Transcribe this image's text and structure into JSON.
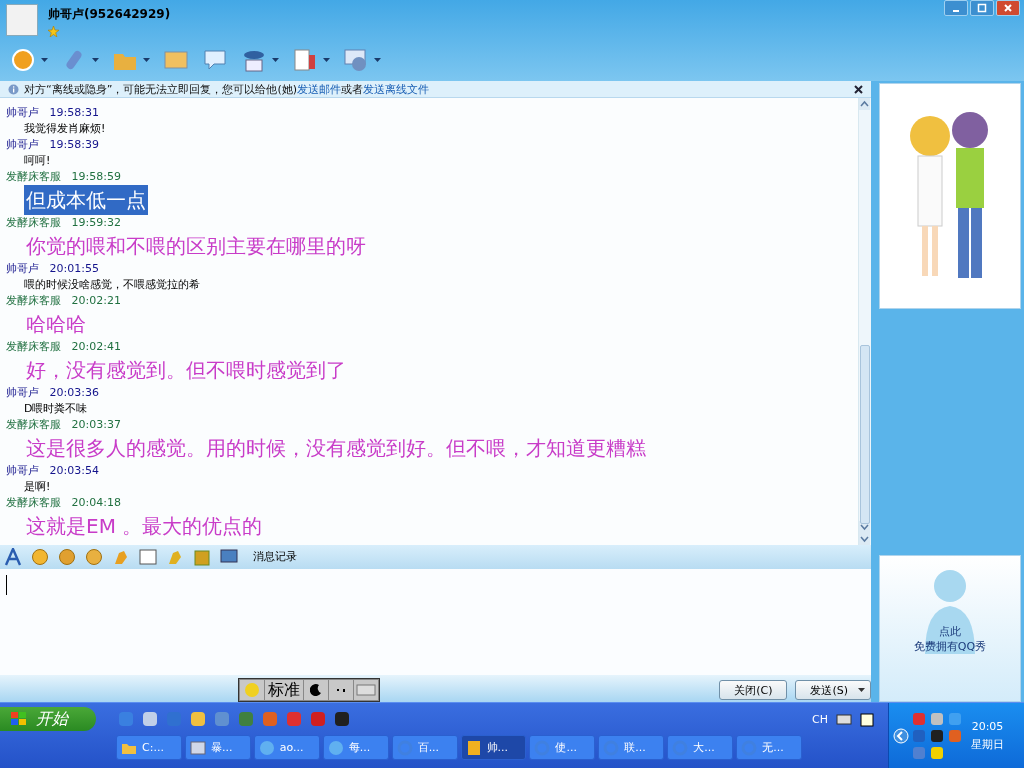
{
  "window": {
    "title": "帅哥卢(952642929)"
  },
  "toolbar": [
    {
      "kind": "webcam",
      "dropdown": true
    },
    {
      "kind": "mic",
      "dropdown": true
    },
    {
      "kind": "folder",
      "dropdown": true
    },
    {
      "kind": "mail",
      "dropdown": false
    },
    {
      "kind": "chat",
      "dropdown": false
    },
    {
      "kind": "person",
      "dropdown": true
    },
    {
      "kind": "cards",
      "dropdown": true
    },
    {
      "kind": "gear",
      "dropdown": true
    }
  ],
  "notice": {
    "text_before": "对方“离线或隐身”，可能无法立即回复，您可以给他(她)",
    "link_1": "发送邮件",
    "text_middle": "或者",
    "link_2": "发送离线文件"
  },
  "messages": [
    {
      "sender": "帅哥卢",
      "kind": "self",
      "time": "19:58:31",
      "text": "我觉得发肖麻烦!",
      "selected": false
    },
    {
      "sender": "帅哥卢",
      "kind": "self",
      "time": "19:58:39",
      "text": "呵呵!",
      "selected": false
    },
    {
      "sender": "发酵床客服",
      "kind": "other",
      "time": "19:58:59",
      "text": "但成本低一点",
      "selected": true
    },
    {
      "sender": "发酵床客服",
      "kind": "other",
      "time": "19:59:32",
      "text": "你觉的喂和不喂的区别主要在哪里的呀",
      "selected": false
    },
    {
      "sender": "帅哥卢",
      "kind": "self",
      "time": "20:01:55",
      "text": "喂的时候没啥感觉，不喂感觉拉的希",
      "selected": false
    },
    {
      "sender": "发酵床客服",
      "kind": "other",
      "time": "20:02:21",
      "text": "哈哈哈",
      "selected": false
    },
    {
      "sender": "发酵床客服",
      "kind": "other",
      "time": "20:02:41",
      "text": "好，没有感觉到。但不喂时感觉到了",
      "selected": false
    },
    {
      "sender": "帅哥卢",
      "kind": "self",
      "time": "20:03:36",
      "text": "D喂时粪不味",
      "selected": false
    },
    {
      "sender": "发酵床客服",
      "kind": "other",
      "time": "20:03:37",
      "text": "这是很多人的感觉。用的时候，没有感觉到好。但不喂，才知道更糟糕",
      "selected": false
    },
    {
      "sender": "帅哥卢",
      "kind": "self",
      "time": "20:03:54",
      "text": "是啊!",
      "selected": false
    },
    {
      "sender": "发酵床客服",
      "kind": "other",
      "time": "20:04:18",
      "text": "这就是EM 。最大的优点的",
      "selected": false
    }
  ],
  "input_toolbar": {
    "tools": [
      {
        "kind": "font"
      },
      {
        "kind": "smiley"
      },
      {
        "kind": "magic"
      },
      {
        "kind": "face"
      },
      {
        "kind": "hand"
      },
      {
        "kind": "image"
      },
      {
        "kind": "duck"
      },
      {
        "kind": "gift"
      },
      {
        "kind": "screen"
      }
    ],
    "history_label": "消息记录"
  },
  "ime": {
    "mode": "标准"
  },
  "buttons": {
    "close": "关闭(C)",
    "send": "发送(S)"
  },
  "show_panel": {
    "line_1": "点此",
    "line_2": "免费拥有QQ秀"
  },
  "taskbar": {
    "start": "开始",
    "tasks": [
      {
        "label": "C:...",
        "kind": "folder",
        "selected": false
      },
      {
        "label": "暴...",
        "kind": "window",
        "selected": false
      },
      {
        "label": "ao...",
        "kind": "bubble",
        "selected": false
      },
      {
        "label": "每...",
        "kind": "bubble",
        "selected": false
      },
      {
        "label": "百...",
        "kind": "browser",
        "selected": false
      },
      {
        "label": "帅...",
        "kind": "note",
        "selected": true
      },
      {
        "label": "使...",
        "kind": "browser",
        "selected": false
      },
      {
        "label": "联...",
        "kind": "browser",
        "selected": false
      },
      {
        "label": "大...",
        "kind": "browser",
        "selected": false
      },
      {
        "label": "无...",
        "kind": "browser",
        "selected": false
      }
    ],
    "language": "CH",
    "time": "20:05",
    "day": "星期日"
  }
}
